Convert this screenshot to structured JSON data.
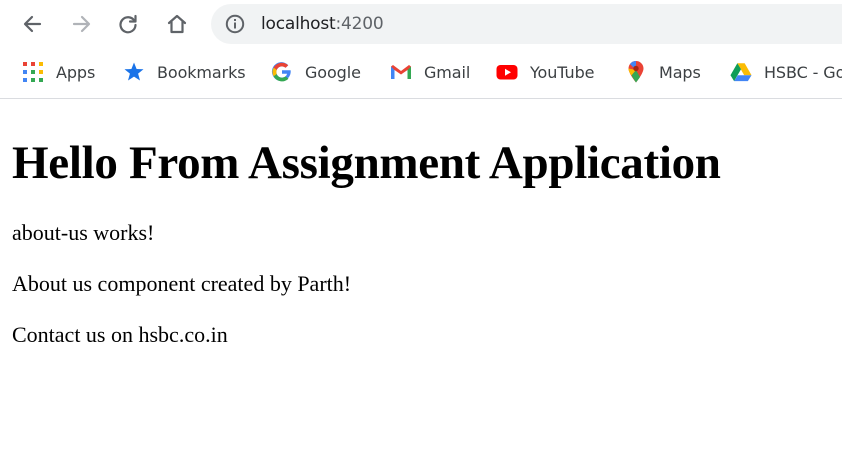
{
  "browser": {
    "url_host": "localhost",
    "url_port": ":4200",
    "bookmarks": [
      {
        "label": "Apps",
        "icon": "apps-grid-icon"
      },
      {
        "label": "Bookmarks",
        "icon": "star-icon"
      },
      {
        "label": "Google",
        "icon": "google-icon"
      },
      {
        "label": "Gmail",
        "icon": "gmail-icon"
      },
      {
        "label": "YouTube",
        "icon": "youtube-icon"
      },
      {
        "label": "Maps",
        "icon": "maps-pin-icon"
      },
      {
        "label": "HSBC - Go",
        "icon": "drive-icon"
      }
    ]
  },
  "page": {
    "heading": "Hello From Assignment Application",
    "line1": "about-us works!",
    "line2": "About us component created by Parth!",
    "line3": "Contact us on hsbc.co.in"
  },
  "colors": {
    "omnibox_bg": "#f1f3f4",
    "star_blue": "#1a73e8",
    "youtube_red": "#ff0000"
  }
}
